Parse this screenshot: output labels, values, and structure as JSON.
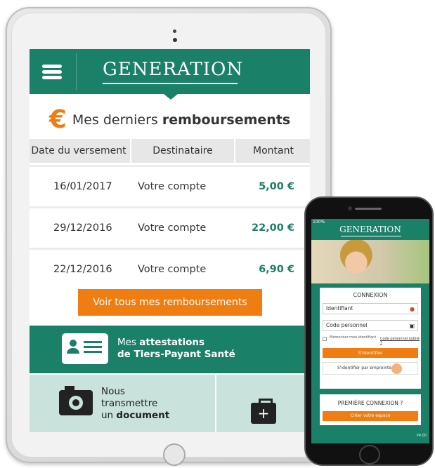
{
  "tablet": {
    "brand": "GENERATION",
    "reimbursements": {
      "currency_symbol": "€",
      "title_prefix": "Mes derniers ",
      "title_bold": "remboursements",
      "columns": [
        "Date du versement",
        "Destinataire",
        "Montant"
      ],
      "rows": [
        {
          "date": "16/01/2017",
          "recipient": "Votre compte",
          "amount": "5,00 €"
        },
        {
          "date": "29/12/2016",
          "recipient": "Votre compte",
          "amount": "22,00 €"
        },
        {
          "date": "22/12/2016",
          "recipient": "Votre compte",
          "amount": "6,90 €"
        }
      ],
      "see_all_label": "Voir tous mes remboursements"
    },
    "attestations": {
      "line1_prefix": "Mes ",
      "line1_bold": "attestations",
      "line2": "de Tiers-Payant Santé"
    },
    "document": {
      "line1": "Nous",
      "line2": "transmettre",
      "line3_prefix": "un ",
      "line3_bold": "document"
    },
    "kit_plus": "+"
  },
  "phone": {
    "status": "100%",
    "brand": "GENERATION",
    "login": {
      "title": "CONNEXION",
      "identifier_placeholder": "Identifiant",
      "code_placeholder": "Code personnel",
      "remember_label": "Mémoriser mon identifiant",
      "forgot_label": "Code personnel oublié ?",
      "submit_label": "S'identifier",
      "fingerprint_label": "S'identifier par empreinte"
    },
    "first": {
      "title": "PREMIÈRE CONNEXION ?",
      "create_label": "Créer votre espace"
    },
    "version": "V4.00"
  },
  "colors": {
    "primary": "#1b8068",
    "accent": "#f07d11",
    "light_panel": "#c9e3dc"
  }
}
